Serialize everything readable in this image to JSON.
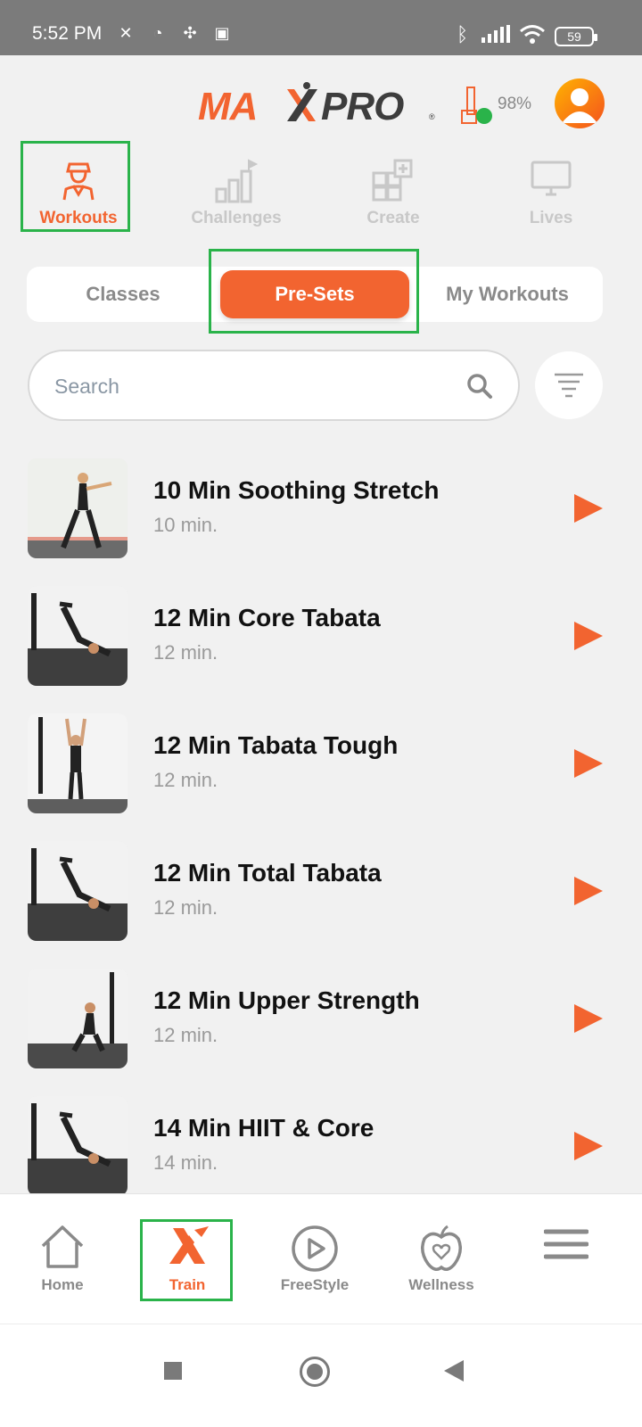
{
  "status_bar": {
    "time": "5:52 PM",
    "battery": "59"
  },
  "header": {
    "logo_text": "MAXPRO",
    "device_percent": "98%"
  },
  "top_tabs": [
    {
      "label": "Workouts",
      "active": true
    },
    {
      "label": "Challenges",
      "active": false
    },
    {
      "label": "Create",
      "active": false
    },
    {
      "label": "Lives",
      "active": false
    }
  ],
  "segments": [
    {
      "label": "Classes",
      "active": false
    },
    {
      "label": "Pre-Sets",
      "active": true
    },
    {
      "label": "My Workouts",
      "active": false
    }
  ],
  "search": {
    "placeholder": "Search"
  },
  "workouts": [
    {
      "title": "10 Min Soothing Stretch",
      "duration": "10 min."
    },
    {
      "title": "12 Min Core Tabata",
      "duration": "12 min."
    },
    {
      "title": "12 Min Tabata Tough",
      "duration": "12 min."
    },
    {
      "title": "12 Min Total Tabata",
      "duration": "12 min."
    },
    {
      "title": "12 Min Upper Strength",
      "duration": "12 min."
    },
    {
      "title": "14 Min HIIT & Core",
      "duration": "14 min."
    }
  ],
  "bottom_nav": [
    {
      "label": "Home",
      "active": false
    },
    {
      "label": "Train",
      "active": true
    },
    {
      "label": "FreeStyle",
      "active": false
    },
    {
      "label": "Wellness",
      "active": false
    },
    {
      "label": "",
      "active": false
    }
  ],
  "colors": {
    "accent": "#f26430",
    "highlight_box": "#2ab34a"
  }
}
